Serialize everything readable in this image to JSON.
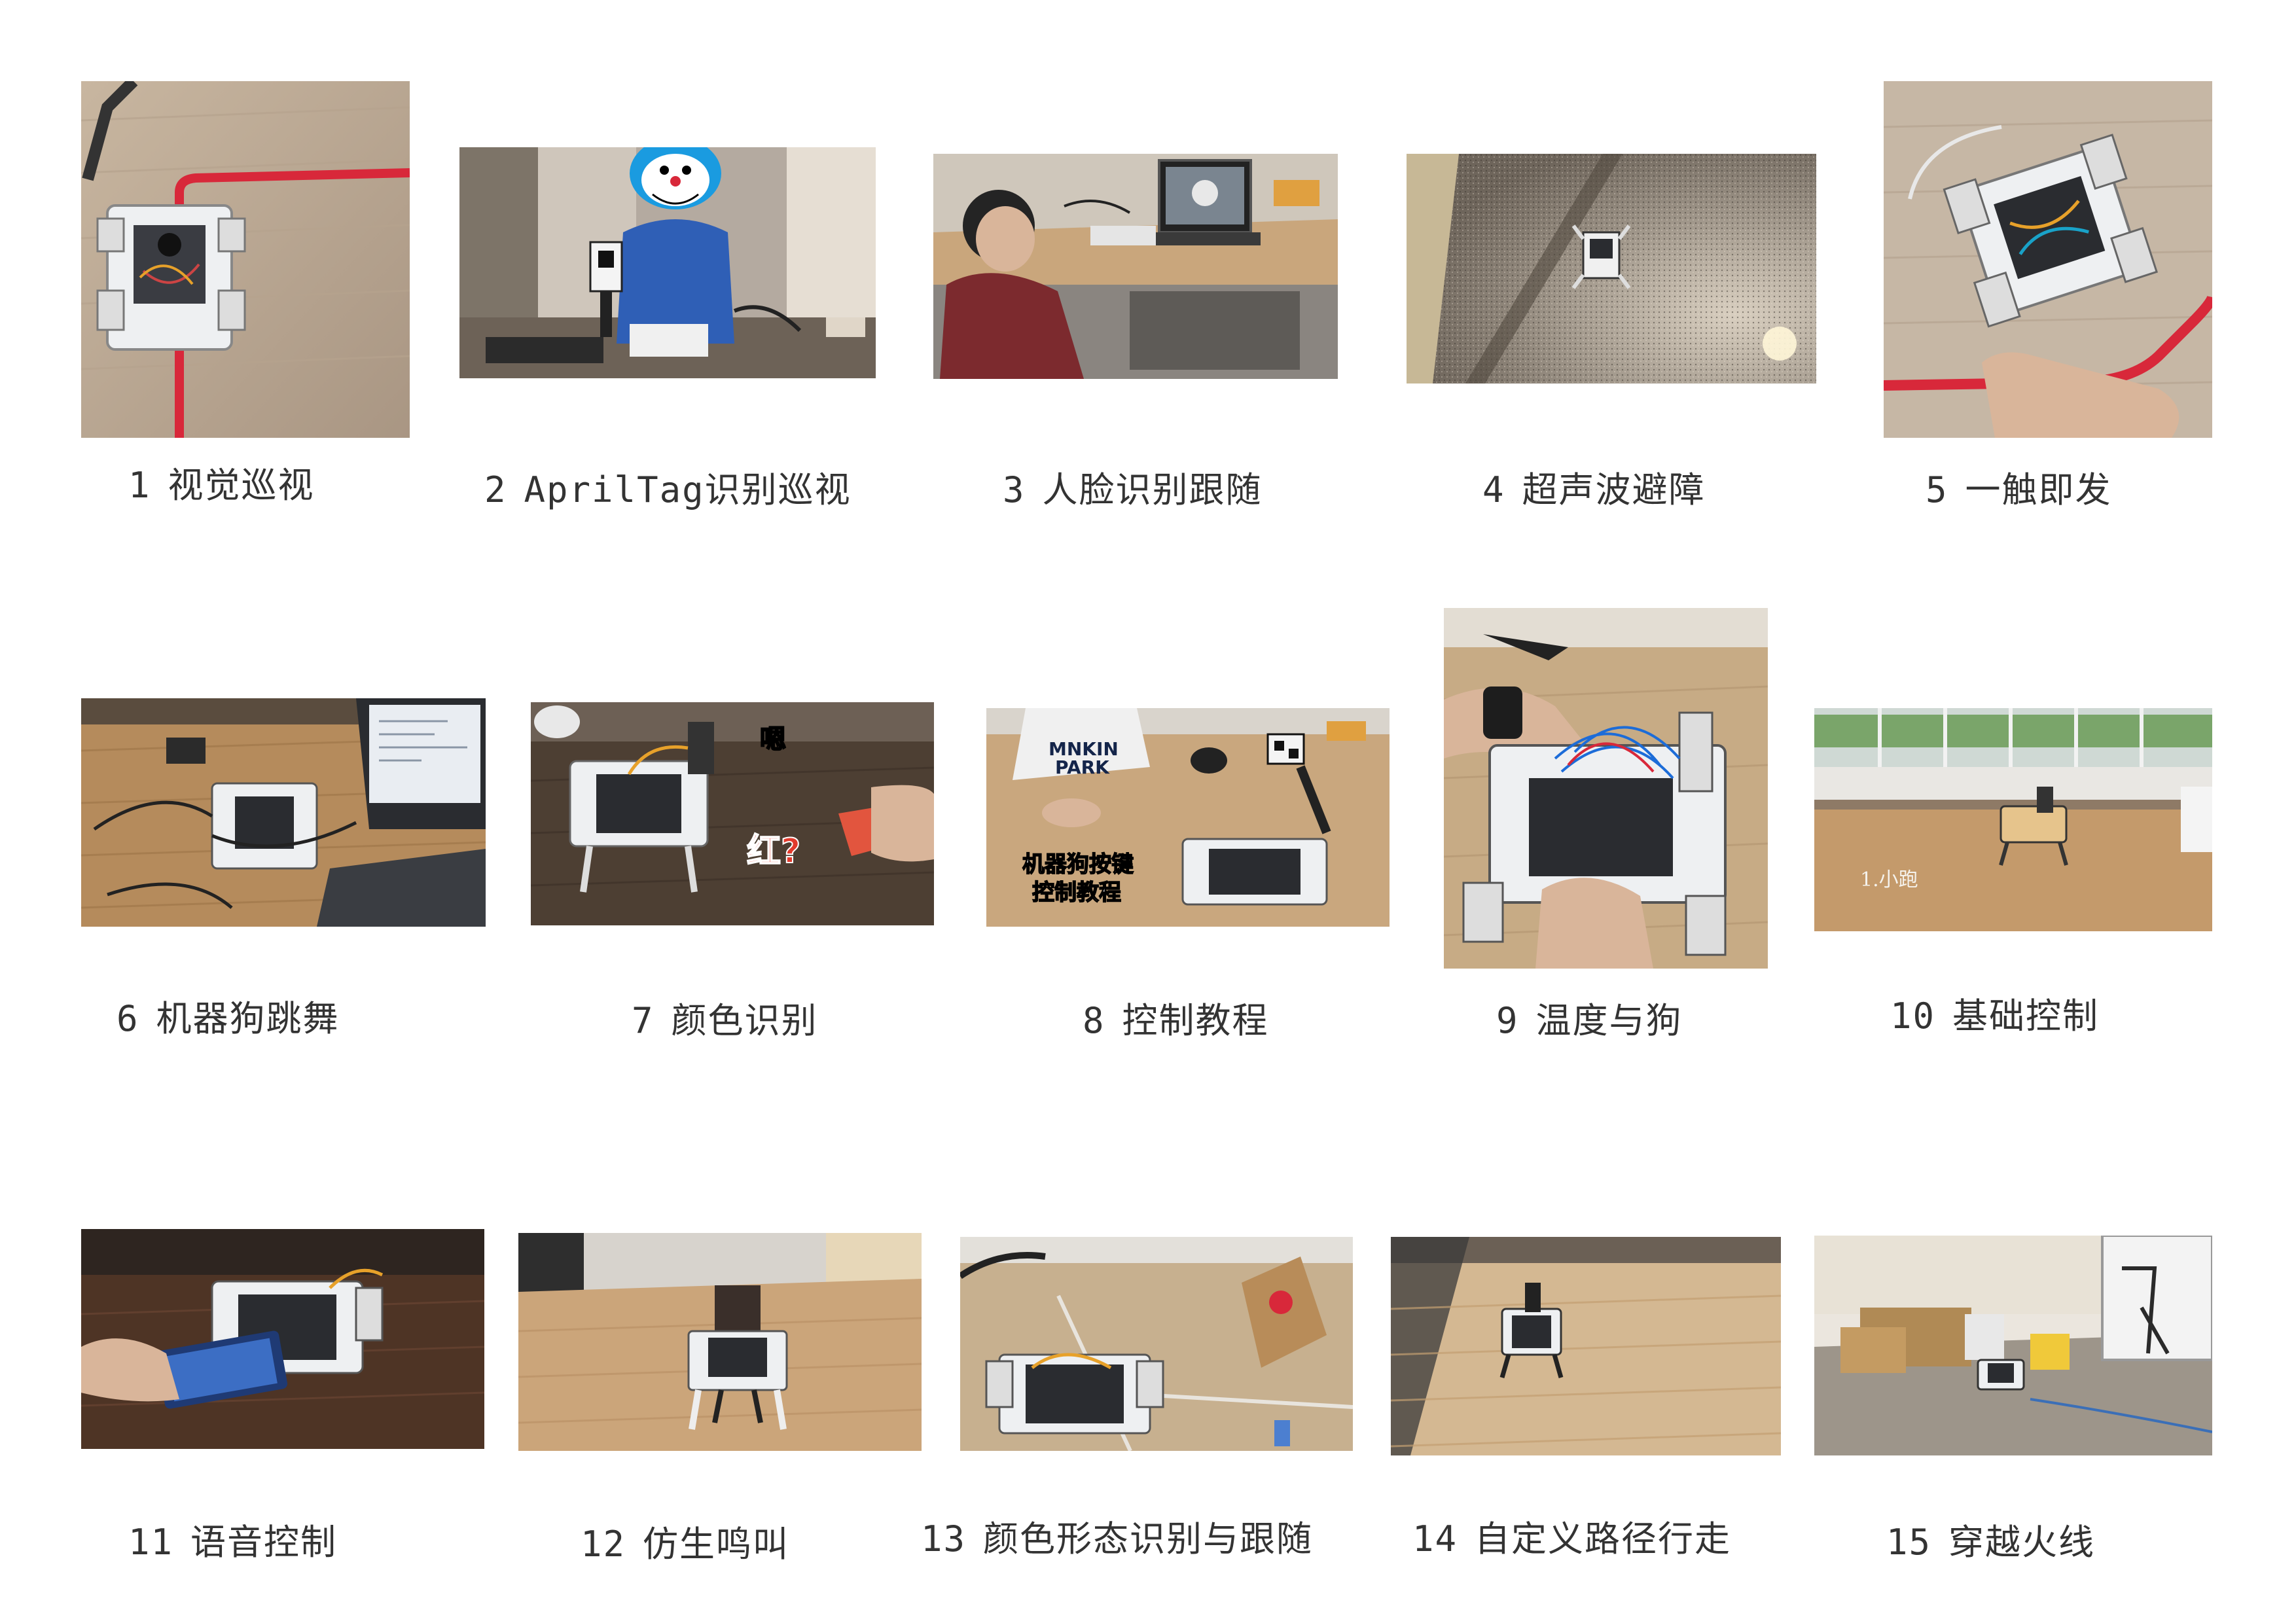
{
  "items": [
    {
      "num": "1",
      "title": "视觉巡视",
      "photo": "robot-on-floor-line-photo"
    },
    {
      "num": "2",
      "title": "AprilTag识别巡视",
      "photo": "apriltag-demo-photo"
    },
    {
      "num": "3",
      "title": "人脸识别跟随",
      "photo": "face-follow-photo"
    },
    {
      "num": "4",
      "title": "超声波避障",
      "photo": "ultrasonic-avoid-photo"
    },
    {
      "num": "5",
      "title": "一触即发",
      "photo": "touch-trigger-photo"
    },
    {
      "num": "6",
      "title": "机器狗跳舞",
      "photo": "dog-dance-photo"
    },
    {
      "num": "7",
      "title": "颜色识别",
      "photo": "color-recognition-photo"
    },
    {
      "num": "8",
      "title": "控制教程",
      "photo": "control-tutorial-photo"
    },
    {
      "num": "9",
      "title": "温度与狗",
      "photo": "temperature-dog-photo"
    },
    {
      "num": "10",
      "title": "基础控制",
      "photo": "basic-control-photo"
    },
    {
      "num": "11",
      "title": "语音控制",
      "photo": "voice-control-photo"
    },
    {
      "num": "12",
      "title": "仿生鸣叫",
      "photo": "bionic-bark-photo"
    },
    {
      "num": "13",
      "title": "颜色形态识别与跟随",
      "photo": "shape-follow-photo"
    },
    {
      "num": "14",
      "title": "自定义路径行走",
      "photo": "custom-path-photo"
    },
    {
      "num": "15",
      "title": "穿越火线",
      "photo": "cross-fire-photo"
    }
  ],
  "overlays": {
    "tile7_top": "嗯",
    "tile7_bottom": "红?",
    "tile8_line1": "机器狗按键",
    "tile8_line2": "控制教程",
    "tile8_shirt1": "MNKIN",
    "tile8_shirt2": "PARK",
    "tile10_sub": "1.小跑"
  },
  "colors": {
    "wood_light": "#c9a77e",
    "wood_dark": "#5b4630",
    "floor_grey": "#8e877c",
    "red_tape": "#d8283a",
    "robot_white": "#eef0f2",
    "robot_dark": "#2a2c30",
    "doraemon_blue": "#1a9be0",
    "jacket_blue": "#2f5fb6"
  }
}
